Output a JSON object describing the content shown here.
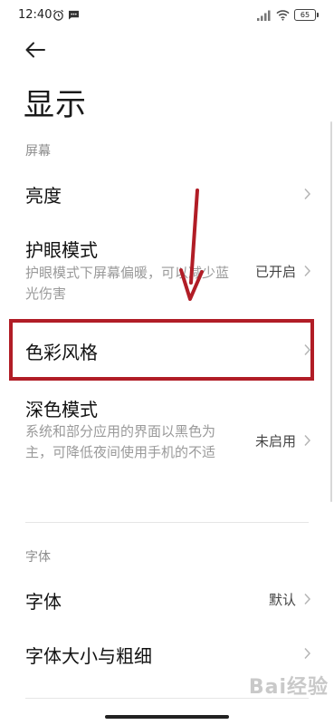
{
  "status_bar": {
    "time": "12:40",
    "battery": "65"
  },
  "page": {
    "title": "显示"
  },
  "sections": [
    {
      "label": "屏幕",
      "items": [
        {
          "title": "亮度",
          "subtitle": "",
          "value": ""
        },
        {
          "title": "护眼模式",
          "subtitle": "护眼模式下屏幕偏暖，可以减少蓝光伤害",
          "value": "已开启"
        },
        {
          "title": "色彩风格",
          "subtitle": "",
          "value": ""
        },
        {
          "title": "深色模式",
          "subtitle": "系统和部分应用的界面以黑色为主，可降低夜间使用手机的不适",
          "value": "未启用"
        }
      ]
    },
    {
      "label": "字体",
      "items": [
        {
          "title": "字体",
          "subtitle": "",
          "value": "默认"
        },
        {
          "title": "字体大小与粗细",
          "subtitle": "",
          "value": ""
        }
      ]
    }
  ],
  "watermark": "Bai经验",
  "colors": {
    "highlight": "#b11d26",
    "arrow": "#b11d26",
    "subtitle": "#9a9a9a",
    "section_label": "#8c8c8c"
  },
  "icons": {
    "back": "arrow-left-icon",
    "chevron": "chevron-right-icon",
    "alarm": "alarm-icon",
    "message": "message-icon",
    "signal": "signal-icon",
    "wifi": "wifi-icon"
  }
}
